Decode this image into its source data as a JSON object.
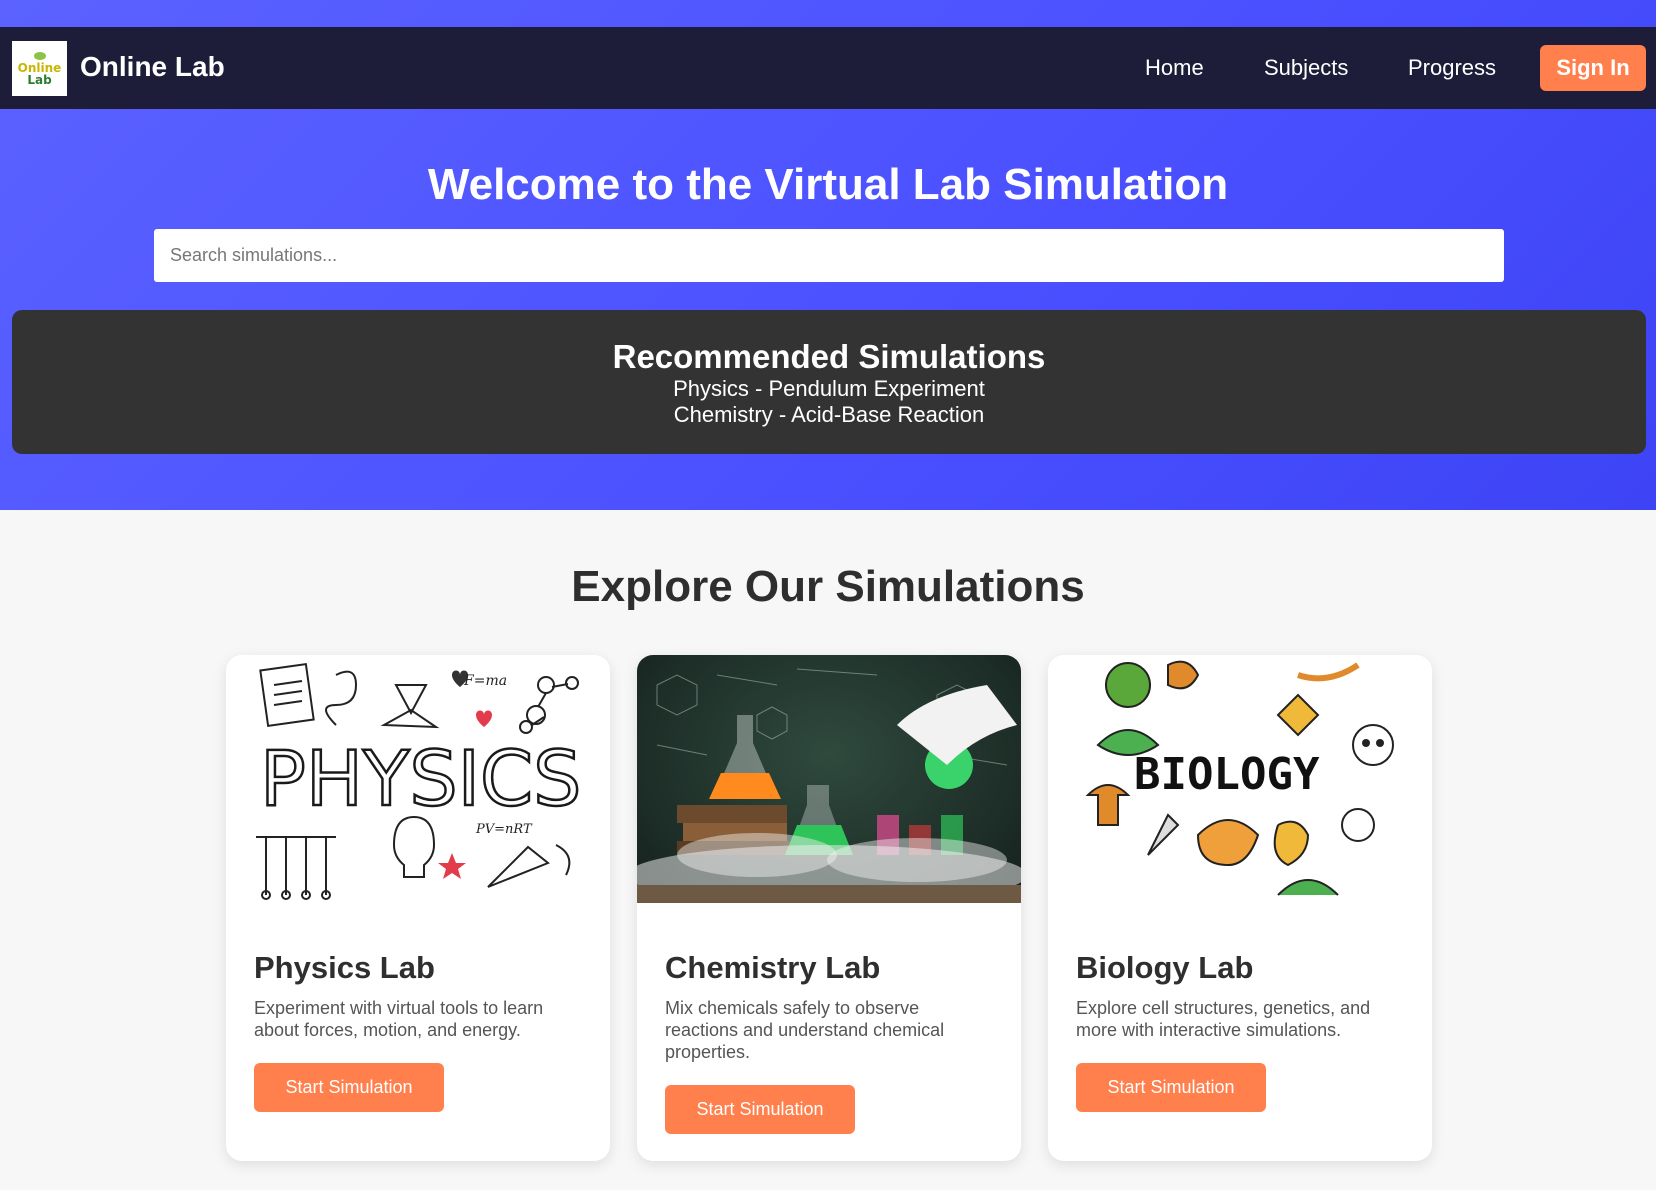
{
  "header": {
    "logo_line1": "Online",
    "logo_line2": "Lab",
    "brand": "Online Lab",
    "nav": [
      "Home",
      "Subjects",
      "Progress"
    ],
    "signin_label": "Sign In"
  },
  "hero": {
    "title": "Welcome to the Virtual Lab Simulation",
    "search_placeholder": "Search simulations..."
  },
  "recommended": {
    "title": "Recommended Simulations",
    "items": [
      "Physics - Pendulum Experiment",
      "Chemistry - Acid-Base Reaction"
    ]
  },
  "explore": {
    "title": "Explore Our Simulations",
    "cards": [
      {
        "image_text": "PHYSICS",
        "formula1": "F=ma",
        "formula2": "PV=nRT",
        "title": "Physics Lab",
        "description": "Experiment with virtual tools to learn about forces, motion, and energy.",
        "button": "Start Simulation"
      },
      {
        "title": "Chemistry Lab",
        "description": "Mix chemicals safely to observe reactions and understand chemical properties.",
        "button": "Start Simulation"
      },
      {
        "image_text": "BIOLOGY",
        "title": "Biology Lab",
        "description": "Explore cell structures, genetics, and more with interactive simulations.",
        "button": "Start Simulation"
      }
    ]
  },
  "colors": {
    "hero_gradient": "#4a50ff",
    "navbar": "#1d1d3a",
    "accent": "#ff7f4d",
    "reco_bg": "#333333"
  }
}
